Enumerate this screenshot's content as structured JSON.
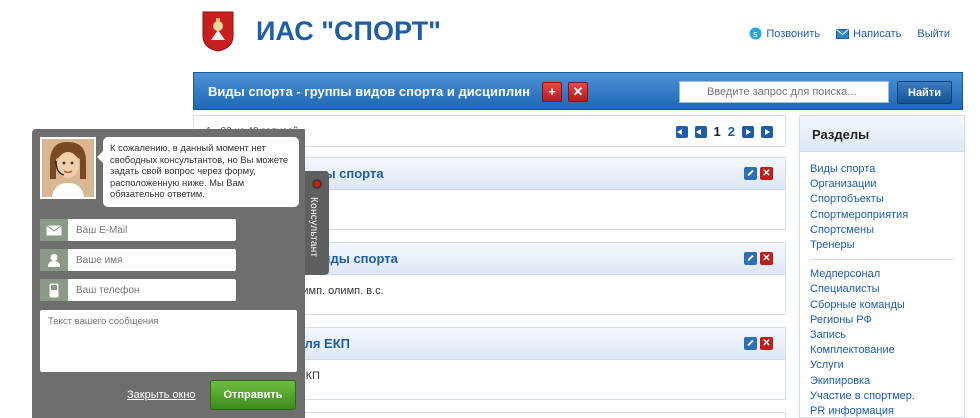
{
  "header": {
    "site_title": "ИАС \"СПОРТ\"",
    "links": [
      {
        "label": "Позвонить",
        "icon": "skype-icon"
      },
      {
        "label": "Написать",
        "icon": "mail-icon"
      },
      {
        "label": "Выйти",
        "icon": ""
      }
    ]
  },
  "toolbar": {
    "title": "Виды спорта - группы видов спорта и дисциплин",
    "add_label": "+",
    "delete_label": "✕",
    "search_placeholder": "Введите запрос для поиска...",
    "search_button": "Найти"
  },
  "pager": {
    "info": "1 - 20 из 40 записей",
    "pages": [
      "1",
      "2"
    ],
    "current": "1"
  },
  "cards": [
    {
      "title": "Олимпийские виды спорта",
      "body": ""
    },
    {
      "title": "Неолимпийские виды спорта",
      "body": "Спорт глухих неолимп. олимп. в.с."
    },
    {
      "title": "Виды спорта для ЕКП",
      "body": "Виды спорта для ЕКП"
    }
  ],
  "sidebar": {
    "title": "Разделы",
    "group1": [
      "Виды спорта",
      "Организации",
      "Спортобъекты",
      "Спортмероприятия",
      "Спортсмены",
      "Тренеры"
    ],
    "group2": [
      "Медперсонал",
      "Специалисты",
      "Сборные команды",
      "Регионы РФ",
      "Запись",
      "Комплектование",
      "Услуги",
      "Экипировка",
      "Участие в спортмер.",
      "PR информация"
    ]
  },
  "consultant": {
    "tab_label": "Консультант",
    "message": "К сожалению, в данный момент нет свободных консультантов, но Вы можете задать свой вопрос через форму, расположенную ниже. Мы Вам обязательно ответим.",
    "email_placeholder": "Ваш E-Mail",
    "name_placeholder": "Ваше имя",
    "phone_placeholder": "Ваш телефон",
    "message_placeholder": "Текст вашего сообщения",
    "close_label": "Закрыть окно",
    "send_label": "Отправить"
  },
  "colors": {
    "brand_blue": "#1f5da8",
    "bar_blue": "#2f79c4",
    "danger": "#c21b1b",
    "send_green": "#4f9f2c",
    "panel_grey": "#6e6e6e"
  }
}
